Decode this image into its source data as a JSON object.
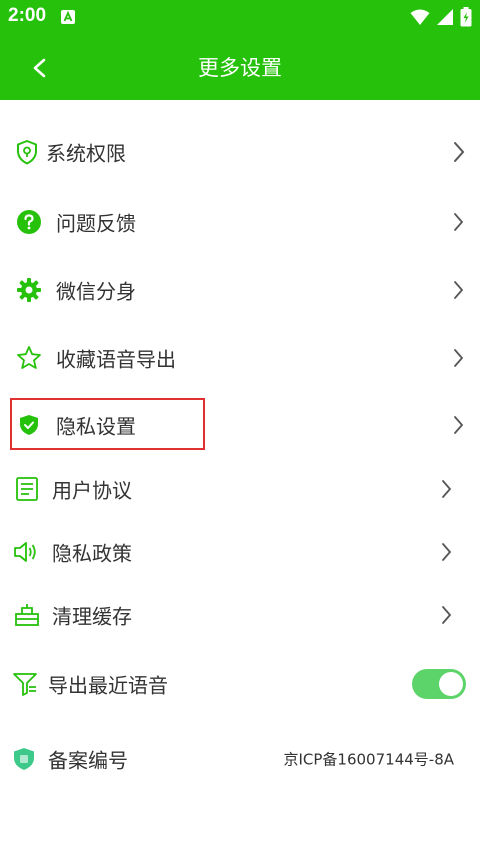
{
  "status_bar": {
    "time": "2:00",
    "app_icon": "a-icon",
    "icons": [
      "wifi-icon",
      "signal-icon",
      "battery-icon"
    ]
  },
  "header": {
    "title": "更多设置",
    "back_icon": "chevron-left-icon"
  },
  "menu": {
    "items": [
      {
        "label": "系统权限",
        "icon": "shield-location-icon"
      },
      {
        "label": "问题反馈",
        "icon": "question-icon"
      },
      {
        "label": "微信分身",
        "icon": "gear-icon"
      },
      {
        "label": "收藏语音导出",
        "icon": "star-icon"
      },
      {
        "label": "隐私设置",
        "icon": "shield-check-icon"
      },
      {
        "label": "用户协议",
        "icon": "document-icon"
      },
      {
        "label": "隐私政策",
        "icon": "speaker-icon"
      },
      {
        "label": "清理缓存",
        "icon": "broom-icon"
      }
    ],
    "export_recent": {
      "label": "导出最近语音",
      "icon": "export-icon",
      "enabled": true
    },
    "record": {
      "label": "备案编号",
      "icon": "record-shield-icon",
      "value": "京ICP备16007144号-8A"
    }
  },
  "colors": {
    "primary": "#25c10b",
    "toggle_on": "#5cd46a",
    "highlight": "#e03030",
    "text": "#333333"
  }
}
